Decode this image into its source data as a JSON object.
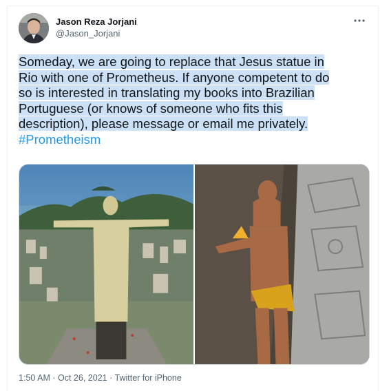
{
  "author": {
    "name": "Jason Reza Jorjani",
    "handle": "@Jason_Jorjani"
  },
  "tweet": {
    "lines": [
      "Someday, we are going to replace that Jesus statue in",
      "Rio with one of Prometheus. If anyone competent to do",
      "so is interested in translating my books into Brazilian",
      "Portuguese (or knows of someone who fits this",
      "description), please message or email me privately."
    ],
    "hashtag": "#Prometheism"
  },
  "meta": {
    "time": "1:50 AM",
    "sep1": "·",
    "date": "Oct 26, 2021",
    "sep2": "·",
    "source": "Twitter for iPhone"
  },
  "colors": {
    "link": "#1d9bf0",
    "selection": "#cce1f5",
    "secondary": "#536471"
  },
  "icons": {
    "more": "more-icon"
  }
}
